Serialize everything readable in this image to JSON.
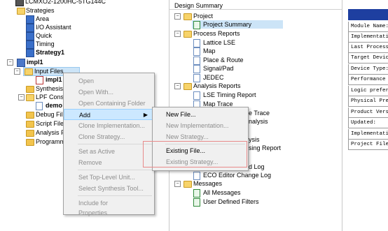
{
  "left_tree": {
    "top_item": "LCMXO2-1200HC-5TG144C",
    "strategies": {
      "label": "Strategies",
      "items": [
        "Area",
        "I/O Assistant",
        "Quick",
        "Timing",
        "Strategy1"
      ]
    },
    "impl": {
      "label": "impl1",
      "input_files": "Input Files",
      "impl_child": "impl1",
      "synthesis": "Synthesis",
      "lpf": "LPF Const",
      "demo": "demo",
      "debug": "Debug Fil",
      "script": "Script File",
      "analysis": "Analysis F",
      "programmer": "Programm"
    }
  },
  "context_menu": {
    "items": [
      {
        "label": "Open",
        "enabled": false
      },
      {
        "label": "Open With...",
        "enabled": false
      },
      {
        "label": "Open Containing Folder",
        "enabled": false
      },
      {
        "label": "Add",
        "enabled": true
      },
      {
        "label": "Clone Implementation...",
        "enabled": false
      },
      {
        "label": "Clone Strategy...",
        "enabled": false
      },
      {
        "label": "Set as Active",
        "enabled": false
      },
      {
        "label": "Remove",
        "enabled": false
      },
      {
        "label": "Set Top-Level Unit...",
        "enabled": false
      },
      {
        "label": "Select Synthesis Tool...",
        "enabled": false
      },
      {
        "label": "Include for",
        "enabled": false
      },
      {
        "label": "Properties",
        "enabled": false
      }
    ]
  },
  "sub_menu": {
    "items": [
      {
        "label": "New File...",
        "enabled": true
      },
      {
        "label": "New Implementation...",
        "enabled": false
      },
      {
        "label": "New Strategy...",
        "enabled": false
      },
      {
        "label": "Existing File...",
        "enabled": true
      },
      {
        "label": "Existing Strategy...",
        "enabled": false
      }
    ]
  },
  "design_summary": {
    "title": "Design Summary",
    "project": "Project",
    "project_summary": "Project Summary",
    "process_reports": "Process Reports",
    "process_items": [
      "Lattice LSE",
      "Map",
      "Place & Route",
      "Signal/Pad",
      "JEDEC"
    ],
    "analysis_reports": "Analysis Reports",
    "analysis_items": [
      "LSE Timing Report",
      "Map Trace"
    ],
    "partial_items": [
      "e Trace",
      "nalysis",
      "ysis",
      "sing Report",
      "d Log"
    ],
    "eco_log": "ECO Editor Change Log",
    "messages": "Messages",
    "message_items": [
      "All Messages",
      "User Defined Filters"
    ]
  },
  "report_table": {
    "rows": [
      "Module Name:",
      "Implementatio",
      "Last Process",
      "Target Devic",
      "Device Type:",
      "Performance G",
      "Logic prefere",
      "Physical Pre",
      "Product Vers",
      "Updated:",
      "Implementatio",
      "Project File"
    ]
  },
  "colors": {
    "menu_bg": "#f0f0f0",
    "menu_highlight": "#cce8ff",
    "selection": "#cce4f7",
    "report_header": "#1e3fa0",
    "callout_border": "#e88a8a"
  }
}
